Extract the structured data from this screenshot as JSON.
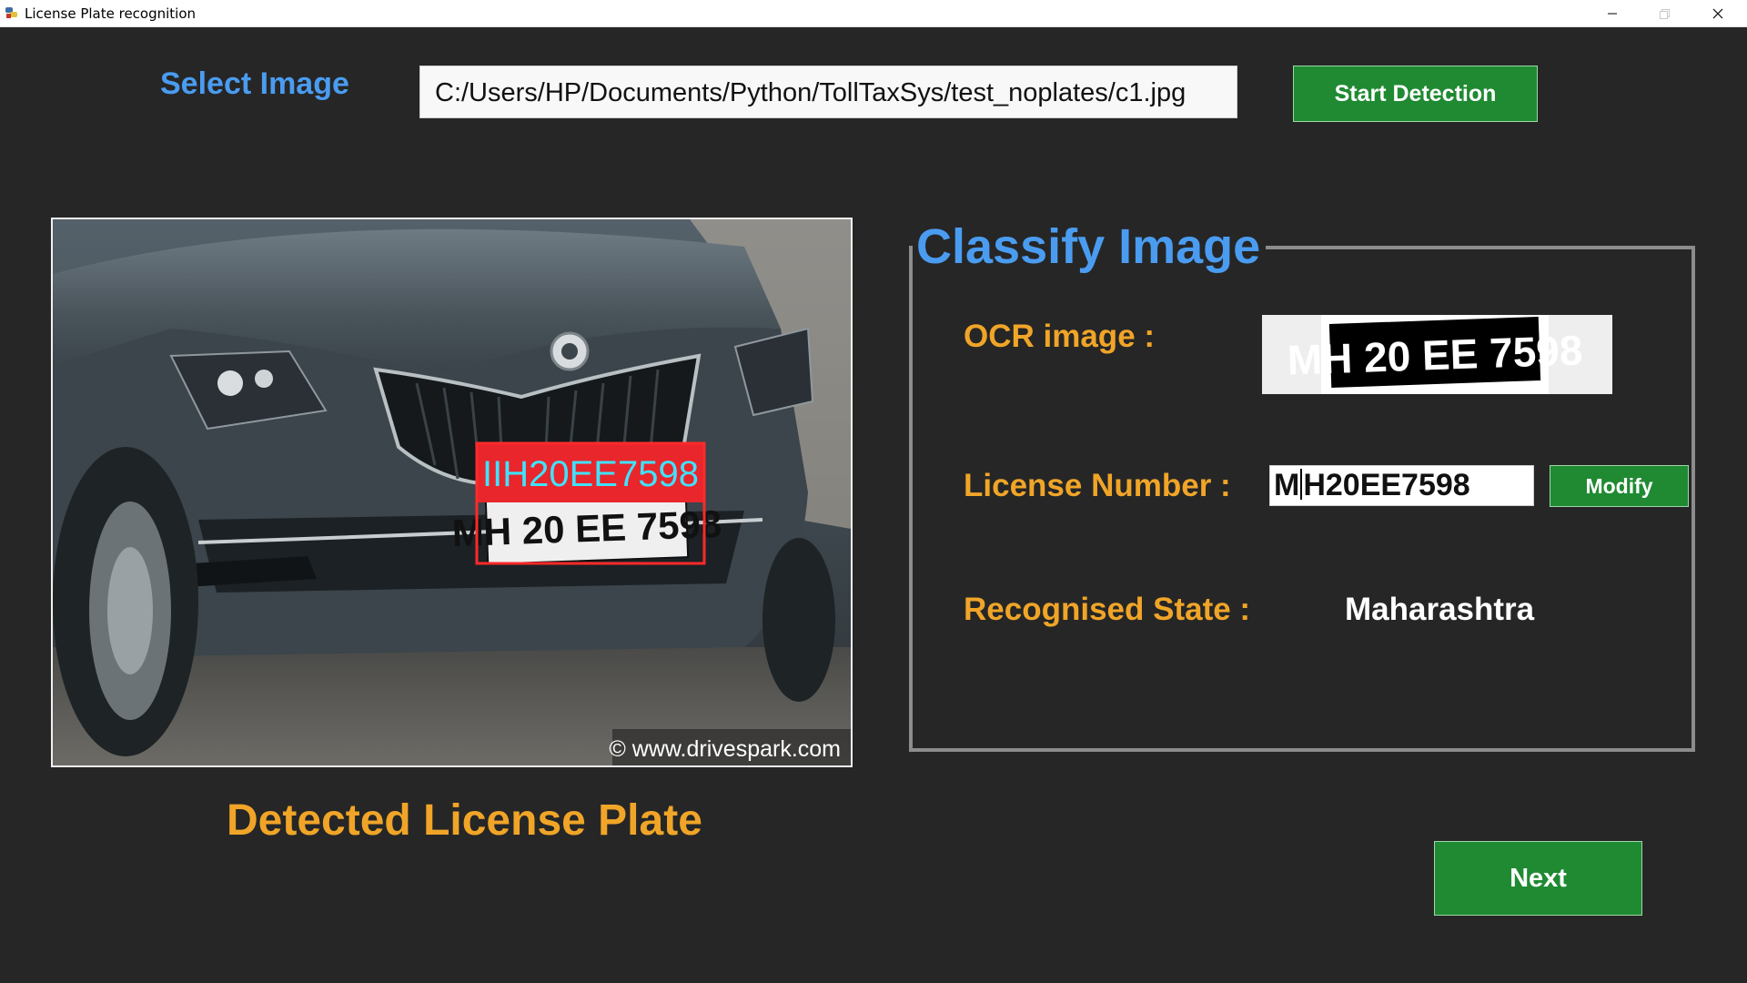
{
  "window": {
    "title": "License Plate recognition",
    "icon": "python-tk-icon",
    "controls": [
      "minimize-icon",
      "maximize-icon",
      "close-icon"
    ]
  },
  "select_image": {
    "label": "Select Image",
    "path_value": "C:/Users/HP/Documents/Python/TollTaxSys/test_noplates/c1.jpg"
  },
  "start_detection": {
    "label": "Start Detection"
  },
  "detected_image": {
    "overlay_text": "IIH20EE7598",
    "plate_text": "MH 20 EE 7598",
    "watermark": "© www.drivespark.com",
    "caption": "Detected License Plate"
  },
  "classify": {
    "title": "Classify Image",
    "ocr_label": "OCR image :",
    "ocr_plate_text": "MH 20 EE 7598",
    "license_label": "License Number :",
    "license_first_char": "M",
    "license_rest": "H20EE7598",
    "modify_label": "Modify",
    "state_label": "Recognised State :",
    "state_value": "Maharashtra"
  },
  "next": {
    "label": "Next"
  },
  "colors": {
    "background": "#262626",
    "accent_blue": "#4a9cf0",
    "accent_orange": "#f0a528",
    "button_green": "#1f8a32",
    "detection_box": "#ff2a2a",
    "overlay_text": "#3fe3ff"
  }
}
